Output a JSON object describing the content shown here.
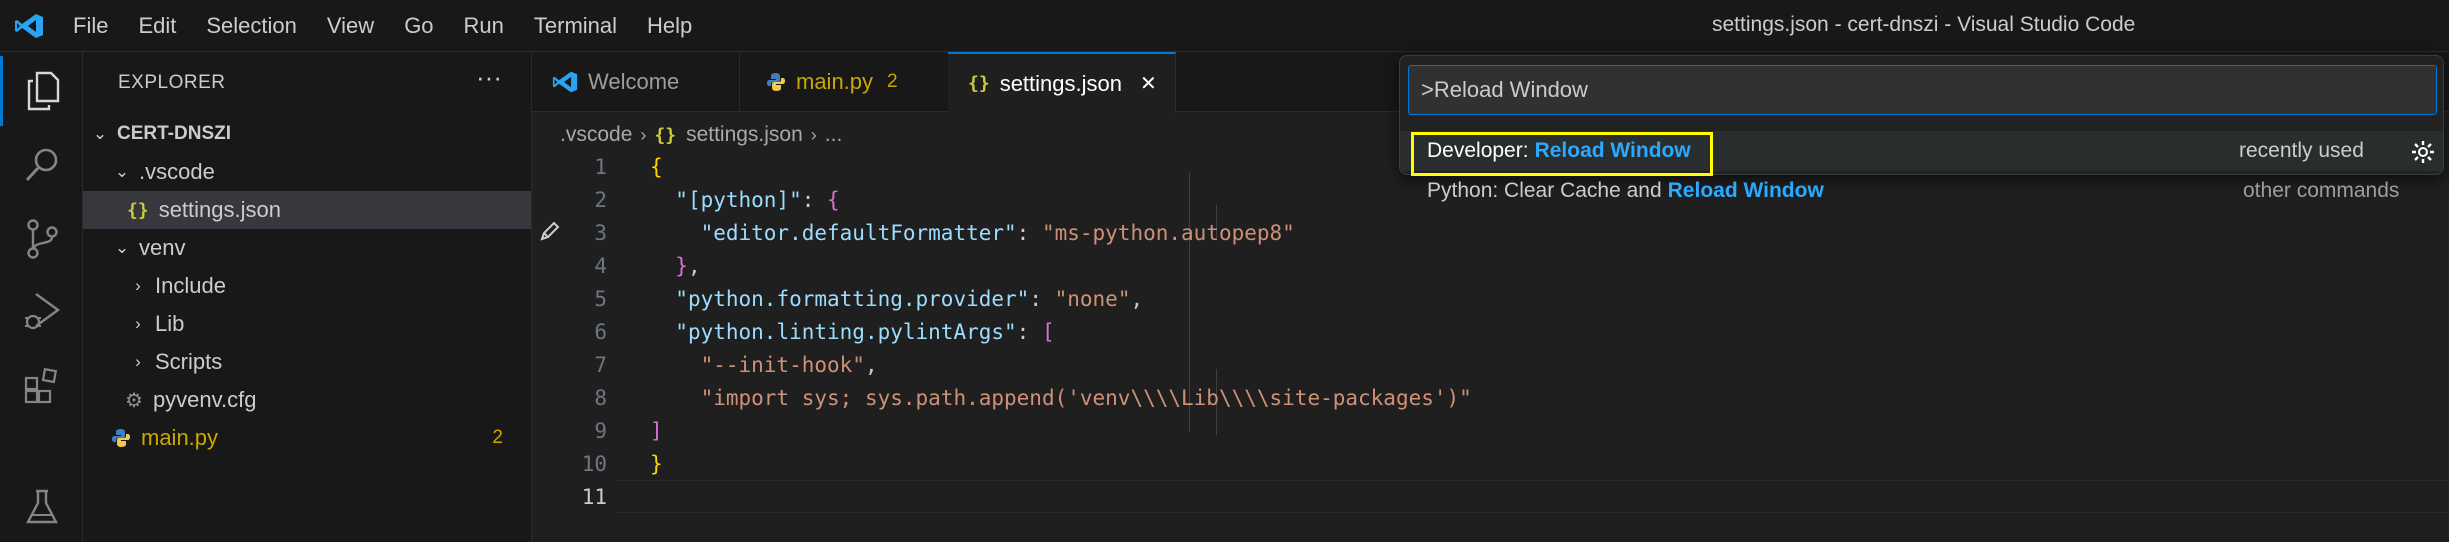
{
  "titlebar": {
    "menu": [
      "File",
      "Edit",
      "Selection",
      "View",
      "Go",
      "Run",
      "Terminal",
      "Help"
    ],
    "window_title": "settings.json - cert-dnszi - Visual Studio Code"
  },
  "activity_bar": {
    "icons": [
      "explorer-icon",
      "search-icon",
      "source-control-icon",
      "run-debug-icon",
      "extensions-icon",
      "testing-icon"
    ]
  },
  "sidebar": {
    "title": "EXPLORER",
    "more": "···",
    "root": "CERT-DNSZI",
    "vscode_folder": ".vscode",
    "settings_file": "settings.json",
    "venv_folder": "venv",
    "include_folder": "Include",
    "lib_folder": "Lib",
    "scripts_folder": "Scripts",
    "pyvenv_file": "pyvenv.cfg",
    "main_file": "main.py",
    "main_problems": "2"
  },
  "tabs": {
    "welcome": "Welcome",
    "main": "main.py",
    "main_problems": "2",
    "settings": "settings.json",
    "close": "✕"
  },
  "breadcrumb": {
    "folder": ".vscode",
    "file": "settings.json",
    "more": "..."
  },
  "editor": {
    "line_numbers": [
      "1",
      "2",
      "3",
      "4",
      "5",
      "6",
      "7",
      "8",
      "9",
      "10",
      "11"
    ],
    "current_line": "11"
  },
  "command_palette": {
    "input_value": ">Reload Window",
    "item1_prefix": "Developer: ",
    "item1_match": "Reload Window",
    "item1_meta": "recently used",
    "item2_prefix": "Python: Clear Cache and ",
    "item2_match": "Reload Window",
    "item2_meta": "other commands"
  },
  "colors": {
    "accent": "#0078d4",
    "highlight_box": "#ffff00",
    "match": "#2aaaff",
    "json_key": "#9cdcfe",
    "json_string": "#ce9178",
    "bracket_yellow": "#ffd700",
    "bracket_pink": "#da70d6",
    "bracket_blue": "#179fff",
    "modified_file": "#cca700"
  }
}
